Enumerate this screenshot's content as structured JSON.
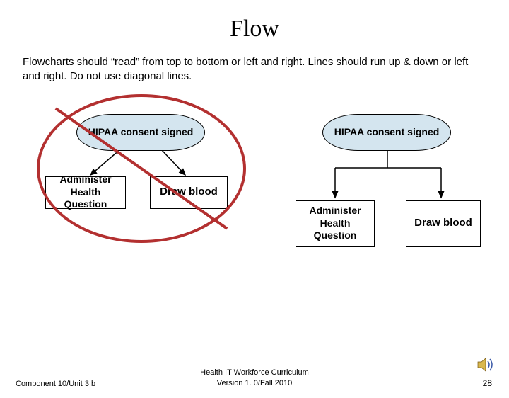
{
  "title": "Flow",
  "description": "Flowcharts should “read” from top to bottom or left and right. Lines should run up & down or left and right.  Do not use diagonal lines.",
  "left_diagram": {
    "top_node": "HIPAA consent signed",
    "bottom_left": "Administer Health Question",
    "bottom_right": "Draw blood",
    "crossed_out": true
  },
  "right_diagram": {
    "top_node": "HIPAA consent signed",
    "bottom_left": "Administer Health Question",
    "bottom_right": "Draw blood"
  },
  "footer": {
    "left": "Component 10/Unit 3 b",
    "center_line1": "Health IT Workforce Curriculum",
    "center_line2": "Version 1. 0/Fall 2010",
    "page": "28"
  }
}
